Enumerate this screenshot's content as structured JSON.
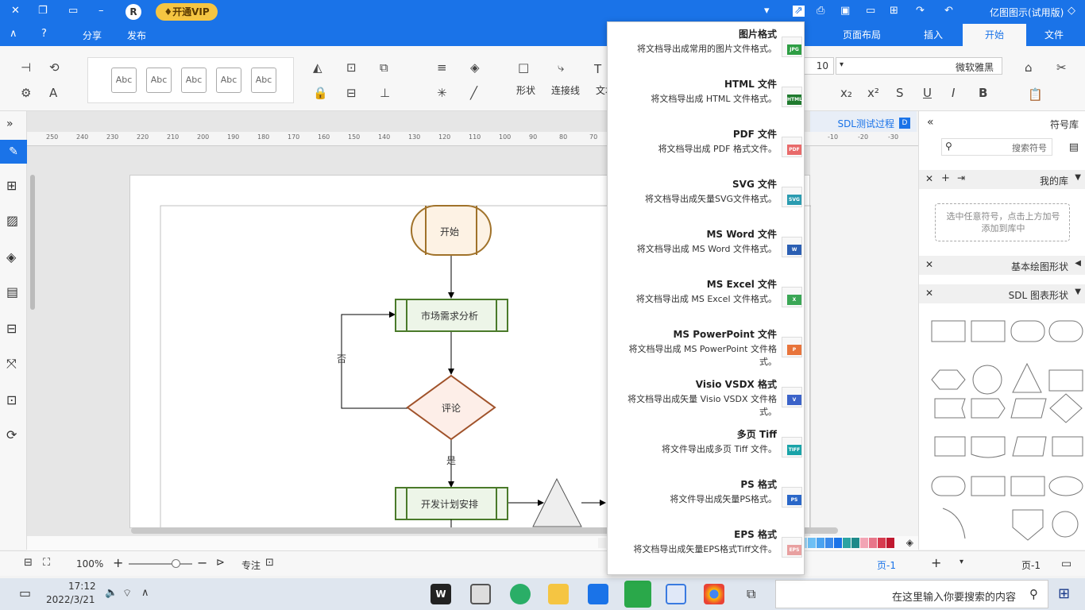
{
  "titlebar": {
    "app_title": "亿图图示(试用版)",
    "vip_label": "开通VIP",
    "avatar_letter": "R"
  },
  "menubar": {
    "tabs": [
      "文件",
      "开始",
      "插入",
      "页面布局"
    ],
    "active_tab": "开始",
    "share": "分享",
    "publish": "发布"
  },
  "ribbon": {
    "font_name": "微软雅黑",
    "font_size": "10",
    "labels": {
      "connector": "连接线",
      "shape": "形状",
      "text": "文本"
    },
    "abc": [
      "Abc",
      "Abc",
      "Abc",
      "Abc",
      "Abc"
    ]
  },
  "doc": {
    "tab": "SDL测试过程",
    "ruler": [
      "250",
      "240",
      "230",
      "220",
      "210",
      "200",
      "190",
      "180",
      "170",
      "160",
      "150",
      "140",
      "130",
      "120",
      "110",
      "100",
      "90",
      "80",
      "70",
      "-10",
      "-20",
      "-30"
    ]
  },
  "flowchart": {
    "start": "开始",
    "step1": "市场需求分析",
    "decision": "评论",
    "no": "否",
    "yes": "是",
    "step2": "开发计划安排"
  },
  "right_panel": {
    "title": "符号库",
    "search_placeholder": "搜索符号",
    "my_lib": "我的库",
    "my_lib_hint": "选中任意符号，点击上方加号添加到库中",
    "basic": "基本绘图形状",
    "sdl": "SDL 图表形状"
  },
  "dropdown": [
    {
      "title": "图片格式",
      "desc": "将文档导出成常用的图片文件格式。",
      "badge": "JPG",
      "color": "#2e9e44"
    },
    {
      "title": "HTML 文件",
      "desc": "将文档导出成 HTML 文件格式。",
      "badge": "HTML",
      "color": "#1f7a2e"
    },
    {
      "title": "PDF 文件",
      "desc": "将文档导出成 PDF 格式文件。",
      "badge": "PDF",
      "color": "#e86a6a"
    },
    {
      "title": "SVG 文件",
      "desc": "将文档导出成矢量SVG文件格式。",
      "badge": "SVG",
      "color": "#2a9bb0"
    },
    {
      "title": "MS Word 文件",
      "desc": "将文档导出成 MS Word 文件格式。",
      "badge": "W",
      "color": "#2b5fb3"
    },
    {
      "title": "MS Excel 文件",
      "desc": "将文档导出成 MS Excel 文件格式。",
      "badge": "X",
      "color": "#3aa655"
    },
    {
      "title": "MS PowerPoint 文件",
      "desc": "将文档导出成 MS PowerPoint 文件格式。",
      "badge": "P",
      "color": "#e8743b"
    },
    {
      "title": "Visio VSDX 格式",
      "desc": "将文档导出成矢量 Visio VSDX 文件格式。",
      "badge": "V",
      "color": "#3b63c9"
    },
    {
      "title": "多页 Tiff",
      "desc": "将文件导出成多页 Tiff 文件。",
      "badge": "TIFF",
      "color": "#19a3a8"
    },
    {
      "title": "PS 格式",
      "desc": "将文件导出成矢量PS格式。",
      "badge": "PS",
      "color": "#2a67c8"
    },
    {
      "title": "EPS 格式",
      "desc": "将文档导出成矢量EPS格式Tiff文件。",
      "badge": "EPS",
      "color": "#e8a0a0"
    }
  ],
  "statusbar": {
    "page_label": "页-1",
    "page_tab": "页-1",
    "focus": "专注",
    "zoom": "100%"
  },
  "taskbar": {
    "search_placeholder": "在这里输入你要搜索的内容",
    "time": "17:12",
    "date": "2022/3/21"
  },
  "palette_colors": [
    "#c0182f",
    "#d73b4f",
    "#e8768a",
    "#f2a4b4",
    "#1e8a8a",
    "#2ba3a3",
    "#1a73e8",
    "#3b8beb",
    "#4ba3f0",
    "#6ec0f5",
    "#a0d8f8",
    "#fadb5a",
    "#f7e46e",
    "#f5ea8c",
    "#c86ce0",
    "#d89cec",
    "#6aa84f",
    "#8cc26e",
    "#e04040",
    "#f07070",
    "#f4a0a0",
    "#3a56d4",
    "#5a76e4",
    "#c07830",
    "#e08a4a",
    "#30b0e0",
    "#50c8f0",
    "#e05a30",
    "#f07850",
    "#a0a0a0",
    "#c0c0c0",
    "#d8d8d8",
    "#e8e8e8",
    "#f0f0f0"
  ]
}
